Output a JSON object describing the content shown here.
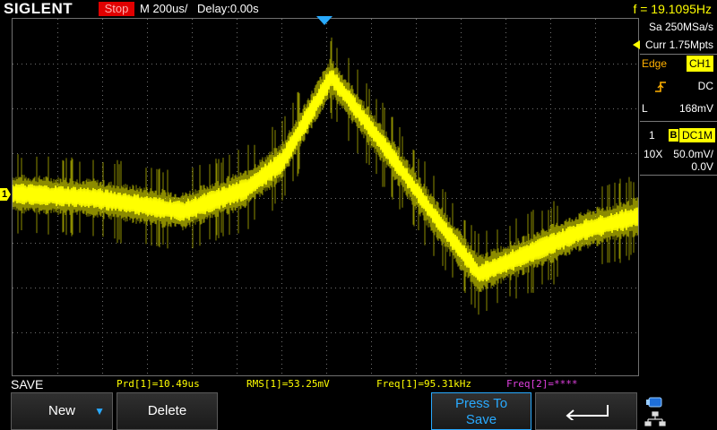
{
  "header": {
    "brand": "SIGLENT",
    "run_state": "Stop",
    "timebase": "M 200us/",
    "delay": "Delay:0.00s",
    "frequency": "f = 19.1095Hz"
  },
  "acquisition": {
    "sample_rate": "Sa 250MSa/s",
    "memory_depth": "Curr 1.75Mpts"
  },
  "trigger": {
    "type": "Edge",
    "source": "CH1",
    "coupling": "DC",
    "level_tag": "L",
    "level": "168mV",
    "slope_icon": "rising-edge-icon"
  },
  "channel1": {
    "number": "1",
    "bw_badge": "B",
    "coupling": "DC1M",
    "probe": "10X",
    "vdiv": "50.0mV/",
    "offset": "0.0V",
    "marker": "1",
    "color": "#ffff00"
  },
  "menu": {
    "title": "SAVE"
  },
  "measurements": [
    "Prd[1]=10.49us",
    "RMS[1]=53.25mV",
    "Freq[1]=95.31kHz",
    "Freq[2]=****"
  ],
  "softkeys": {
    "new": "New",
    "delete": "Delete",
    "press_to_save_line1": "Press To",
    "press_to_save_line2": "Save"
  },
  "colors": {
    "accent": "#29aaff",
    "run_state": "#e00000",
    "ch2": "#e040e0"
  }
}
